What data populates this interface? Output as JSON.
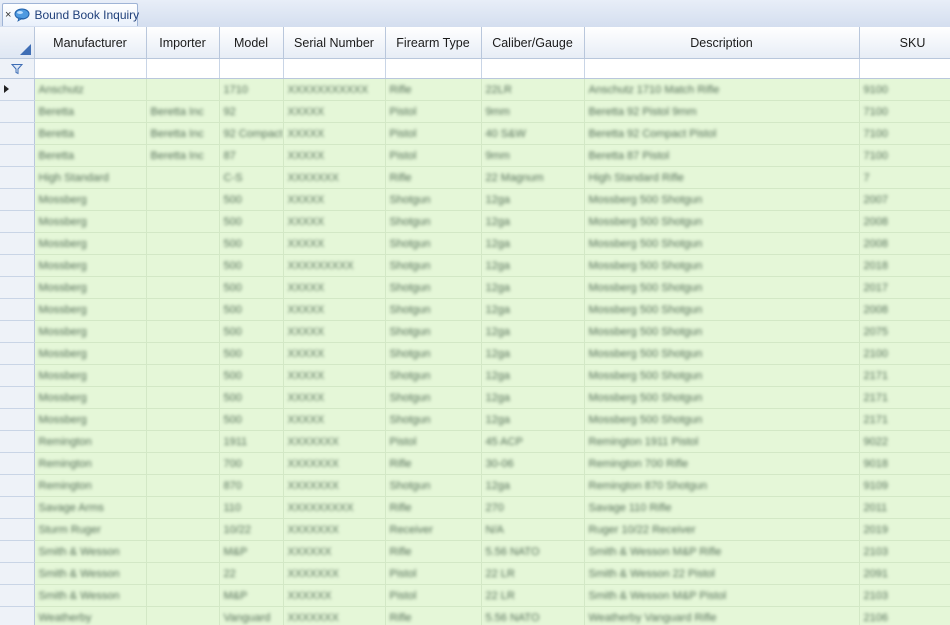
{
  "tab": {
    "title": "Bound Book Inquiry",
    "close_glyph": "×",
    "icon": "speech-bubble-icon"
  },
  "columns": [
    "Manufacturer",
    "Importer",
    "Model",
    "Serial Number",
    "Firearm Type",
    "Caliber/Gauge",
    "Description",
    "SKU"
  ],
  "rows": [
    [
      "Anschutz",
      "",
      "1710",
      "XXXXXXXXXXX",
      "Rifle",
      "22LR",
      "Anschutz 1710 Match Rifle",
      "9100"
    ],
    [
      "Beretta",
      "Beretta Inc",
      "92",
      "XXXXX",
      "Pistol",
      "9mm",
      "Beretta 92 Pistol 9mm",
      "7100"
    ],
    [
      "Beretta",
      "Beretta Inc",
      "92 Compact",
      "XXXXX",
      "Pistol",
      "40 S&W",
      "Beretta 92 Compact Pistol",
      "7100"
    ],
    [
      "Beretta",
      "Beretta Inc",
      "87",
      "XXXXX",
      "Pistol",
      "9mm",
      "Beretta 87 Pistol",
      "7100"
    ],
    [
      "High Standard",
      "",
      "C-S",
      "XXXXXXX",
      "Rifle",
      "22 Magnum",
      "High Standard Rifle",
      "7"
    ],
    [
      "Mossberg",
      "",
      "500",
      "XXXXX",
      "Shotgun",
      "12ga",
      "Mossberg 500 Shotgun",
      "2007"
    ],
    [
      "Mossberg",
      "",
      "500",
      "XXXXX",
      "Shotgun",
      "12ga",
      "Mossberg 500 Shotgun",
      "2008"
    ],
    [
      "Mossberg",
      "",
      "500",
      "XXXXX",
      "Shotgun",
      "12ga",
      "Mossberg 500 Shotgun",
      "2008"
    ],
    [
      "Mossberg",
      "",
      "500",
      "XXXXXXXXX",
      "Shotgun",
      "12ga",
      "Mossberg 500 Shotgun",
      "2018"
    ],
    [
      "Mossberg",
      "",
      "500",
      "XXXXX",
      "Shotgun",
      "12ga",
      "Mossberg 500 Shotgun",
      "2017"
    ],
    [
      "Mossberg",
      "",
      "500",
      "XXXXX",
      "Shotgun",
      "12ga",
      "Mossberg 500 Shotgun",
      "2008"
    ],
    [
      "Mossberg",
      "",
      "500",
      "XXXXX",
      "Shotgun",
      "12ga",
      "Mossberg 500 Shotgun",
      "2075"
    ],
    [
      "Mossberg",
      "",
      "500",
      "XXXXX",
      "Shotgun",
      "12ga",
      "Mossberg 500 Shotgun",
      "2100"
    ],
    [
      "Mossberg",
      "",
      "500",
      "XXXXX",
      "Shotgun",
      "12ga",
      "Mossberg 500 Shotgun",
      "2171"
    ],
    [
      "Mossberg",
      "",
      "500",
      "XXXXX",
      "Shotgun",
      "12ga",
      "Mossberg 500 Shotgun",
      "2171"
    ],
    [
      "Mossberg",
      "",
      "500",
      "XXXXX",
      "Shotgun",
      "12ga",
      "Mossberg 500 Shotgun",
      "2171"
    ],
    [
      "Remington",
      "",
      "1911",
      "XXXXXXX",
      "Pistol",
      "45 ACP",
      "Remington 1911 Pistol",
      "9022"
    ],
    [
      "Remington",
      "",
      "700",
      "XXXXXXX",
      "Rifle",
      "30-06",
      "Remington 700 Rifle",
      "9018"
    ],
    [
      "Remington",
      "",
      "870",
      "XXXXXXX",
      "Shotgun",
      "12ga",
      "Remington 870 Shotgun",
      "9109"
    ],
    [
      "Savage Arms",
      "",
      "110",
      "XXXXXXXXX",
      "Rifle",
      "270",
      "Savage 110 Rifle",
      "2011"
    ],
    [
      "Sturm Ruger",
      "",
      "10/22",
      "XXXXXXX",
      "Receiver",
      "N/A",
      "Ruger 10/22 Receiver",
      "2019"
    ],
    [
      "Smith & Wesson",
      "",
      "M&P",
      "XXXXXX",
      "Rifle",
      "5.56 NATO",
      "Smith & Wesson M&P Rifle",
      "2103"
    ],
    [
      "Smith & Wesson",
      "",
      "22",
      "XXXXXXX",
      "Pistol",
      "22 LR",
      "Smith & Wesson 22 Pistol",
      "2091"
    ],
    [
      "Smith & Wesson",
      "",
      "M&P",
      "XXXXXX",
      "Pistol",
      "22 LR",
      "Smith & Wesson M&P Pistol",
      "2103"
    ],
    [
      "Weatherby",
      "",
      "Vanguard",
      "XXXXXXX",
      "Rifle",
      "5.56 NATO",
      "Weatherby Vanguard Rifle",
      "2106"
    ]
  ]
}
